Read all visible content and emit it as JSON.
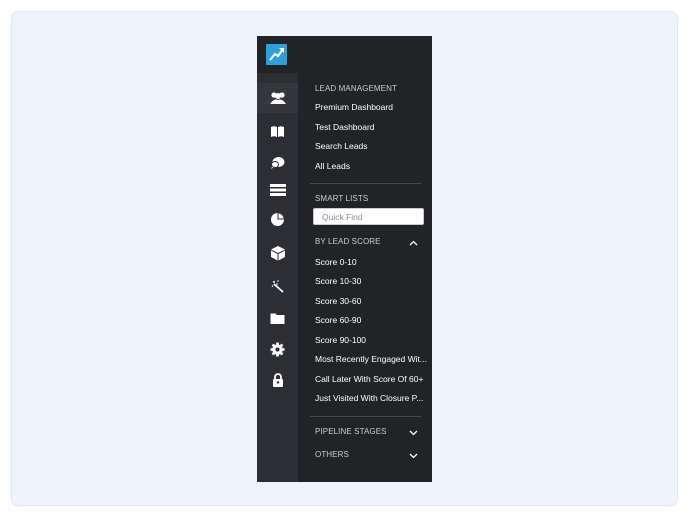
{
  "sections": {
    "lead_management": {
      "title": "LEAD MANAGEMENT",
      "items": [
        "Premium Dashboard",
        "Test Dashboard",
        "Search Leads",
        "All Leads"
      ]
    },
    "smart_lists": {
      "title": "SMART LISTS",
      "quick_find_placeholder": "Quick Find",
      "by_lead_score": {
        "title": "BY LEAD SCORE",
        "expanded": true,
        "items": [
          "Score 0-10",
          "Score 10-30",
          "Score 30-60",
          "Score 60-90",
          "Score 90-100",
          "Most Recently Engaged Wit...",
          "Call Later With Score Of 60+",
          "Just Visited With Closure P..."
        ]
      }
    },
    "pipeline_stages": {
      "title": "PIPELINE STAGES",
      "expanded": false
    },
    "others": {
      "title": "OTHERS",
      "expanded": false
    }
  },
  "rail_icons": [
    "users-icon",
    "book-icon",
    "chat-icon",
    "list-icon",
    "pie-chart-icon",
    "cube-icon",
    "magic-wand-icon",
    "folder-icon",
    "gear-icon",
    "lock-icon"
  ],
  "active_rail_icon": "users-icon",
  "colors": {
    "sidebar_bg": "#212327",
    "rail_bg": "#2c2e33",
    "brand": "#2e9fd8",
    "text": "#ffffff",
    "muted_text": "#c9cbd1",
    "page_bg": "#eef3fd"
  }
}
